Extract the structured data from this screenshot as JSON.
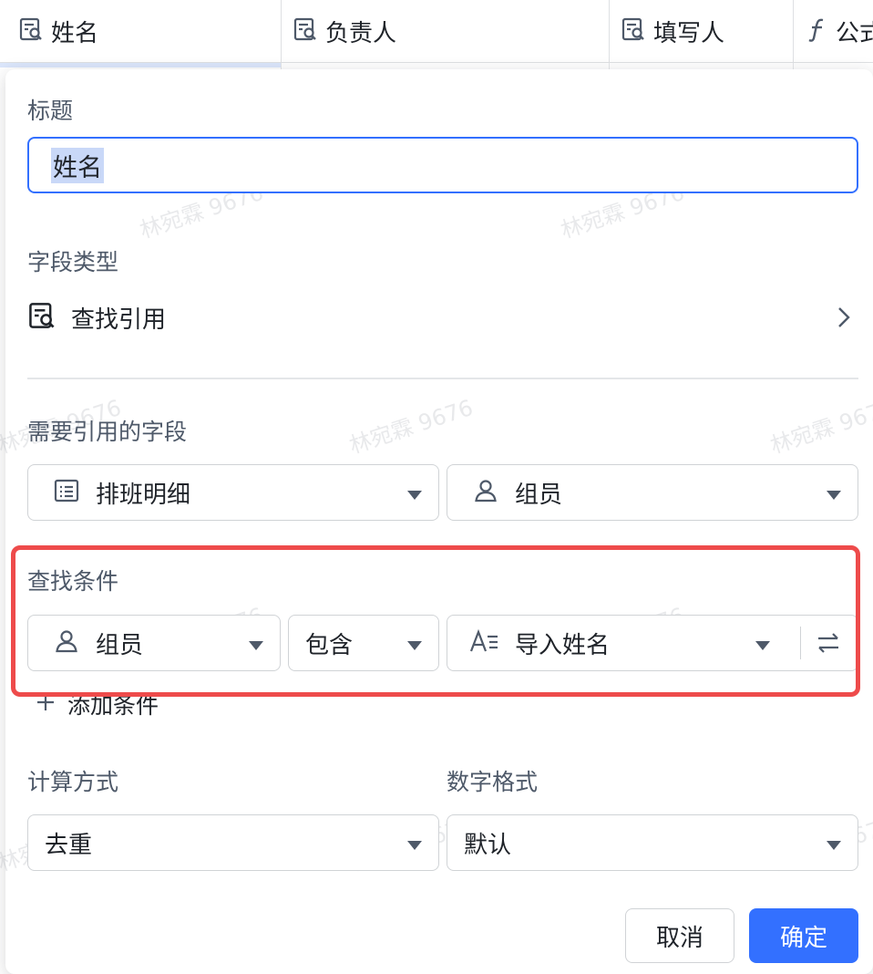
{
  "table_header": {
    "columns": [
      {
        "label": "姓名",
        "icon": "lookup-icon"
      },
      {
        "label": "负责人",
        "icon": "lookup-icon"
      },
      {
        "label": "填写人",
        "icon": "lookup-icon"
      },
      {
        "label": "公式",
        "icon": "formula-icon"
      }
    ]
  },
  "panel": {
    "title_label": "标题",
    "title_value": "姓名",
    "field_type_label": "字段类型",
    "field_type_value": "查找引用",
    "ref_field_label": "需要引用的字段",
    "ref_table": "排班明细",
    "ref_field": "组员",
    "condition_label": "查找条件",
    "condition": {
      "field": "组员",
      "operator": "包含",
      "value": "导入姓名"
    },
    "add_condition": "添加条件",
    "calc_label": "计算方式",
    "calc_value": "去重",
    "number_format_label": "数字格式",
    "number_format_value": "默认",
    "cancel_label": "取消",
    "confirm_label": "确定"
  },
  "watermark": "林宛霖 9676",
  "colors": {
    "accent": "#3370ff",
    "highlight_border": "#ee4b4b"
  }
}
